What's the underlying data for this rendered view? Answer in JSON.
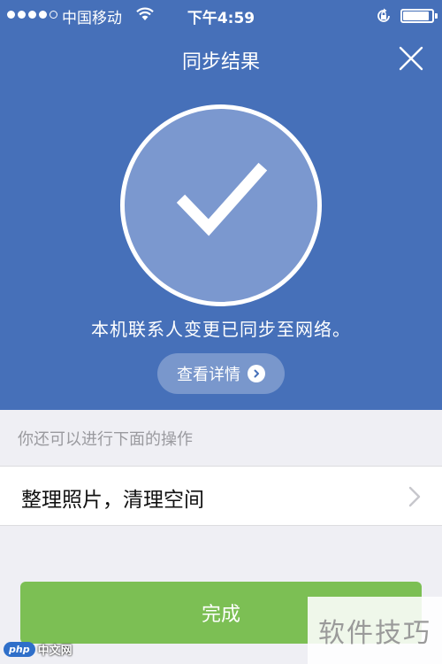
{
  "status_bar": {
    "carrier": "中国移动",
    "time": "下午4:59",
    "battery_level": 0.92,
    "signal_bars": 4,
    "signal_total": 5
  },
  "header": {
    "title": "同步结果",
    "close_icon": "close-icon"
  },
  "result": {
    "icon": "checkmark-icon",
    "message": "本机联系人变更已同步至网络。",
    "details_label": "查看详情",
    "details_icon": "arrow-right-circle-icon"
  },
  "actions": {
    "section_label": "你还可以进行下面的操作",
    "items": [
      {
        "label": "整理照片，清理空间",
        "icon": "chevron-right-icon"
      }
    ]
  },
  "footer": {
    "done_label": "完成"
  },
  "watermark": {
    "text": "软件技巧",
    "logo_badge": "php",
    "logo_site": "中文网"
  },
  "colors": {
    "header_bg": "#4670b9",
    "circle_fill": "#7b98cf",
    "done_button": "#7cbf54",
    "page_bg": "#efeff4"
  }
}
